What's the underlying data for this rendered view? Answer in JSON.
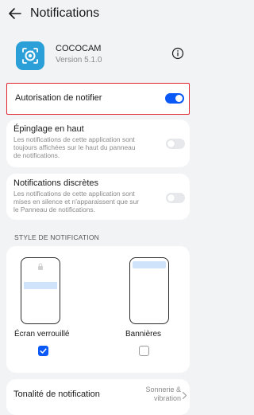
{
  "header": {
    "title": "Notifications"
  },
  "app": {
    "name": "COCOCAM",
    "version": "Version 5.1.0"
  },
  "permission": {
    "label": "Autorisation de notifier",
    "enabled": true
  },
  "pinned": {
    "title": "Épinglage en haut",
    "desc_lines": [
      "Les notifications de cette application sont",
      "toujours affichées sur le haut du panneau",
      "de notifications."
    ],
    "enabled": false
  },
  "discreet": {
    "title": "Notifications discrètes",
    "desc_lines": [
      "Les notifications de cette application sont",
      "mises en silence et n'apparaissent que sur",
      "le Panneau de notifications."
    ],
    "enabled": false
  },
  "style": {
    "section_label": "STYLE DE NOTIFICATION",
    "options": [
      {
        "label": "Écran verrouillé",
        "checked": true
      },
      {
        "label": "Bannières",
        "checked": false
      }
    ]
  },
  "tone": {
    "label": "Tonalité de notification",
    "value_lines": [
      "Sonnerie &",
      "vibration"
    ]
  },
  "colors": {
    "accent": "#0a59f7",
    "highlight": "#e0262c",
    "app_icon": "#2b9fd8"
  }
}
